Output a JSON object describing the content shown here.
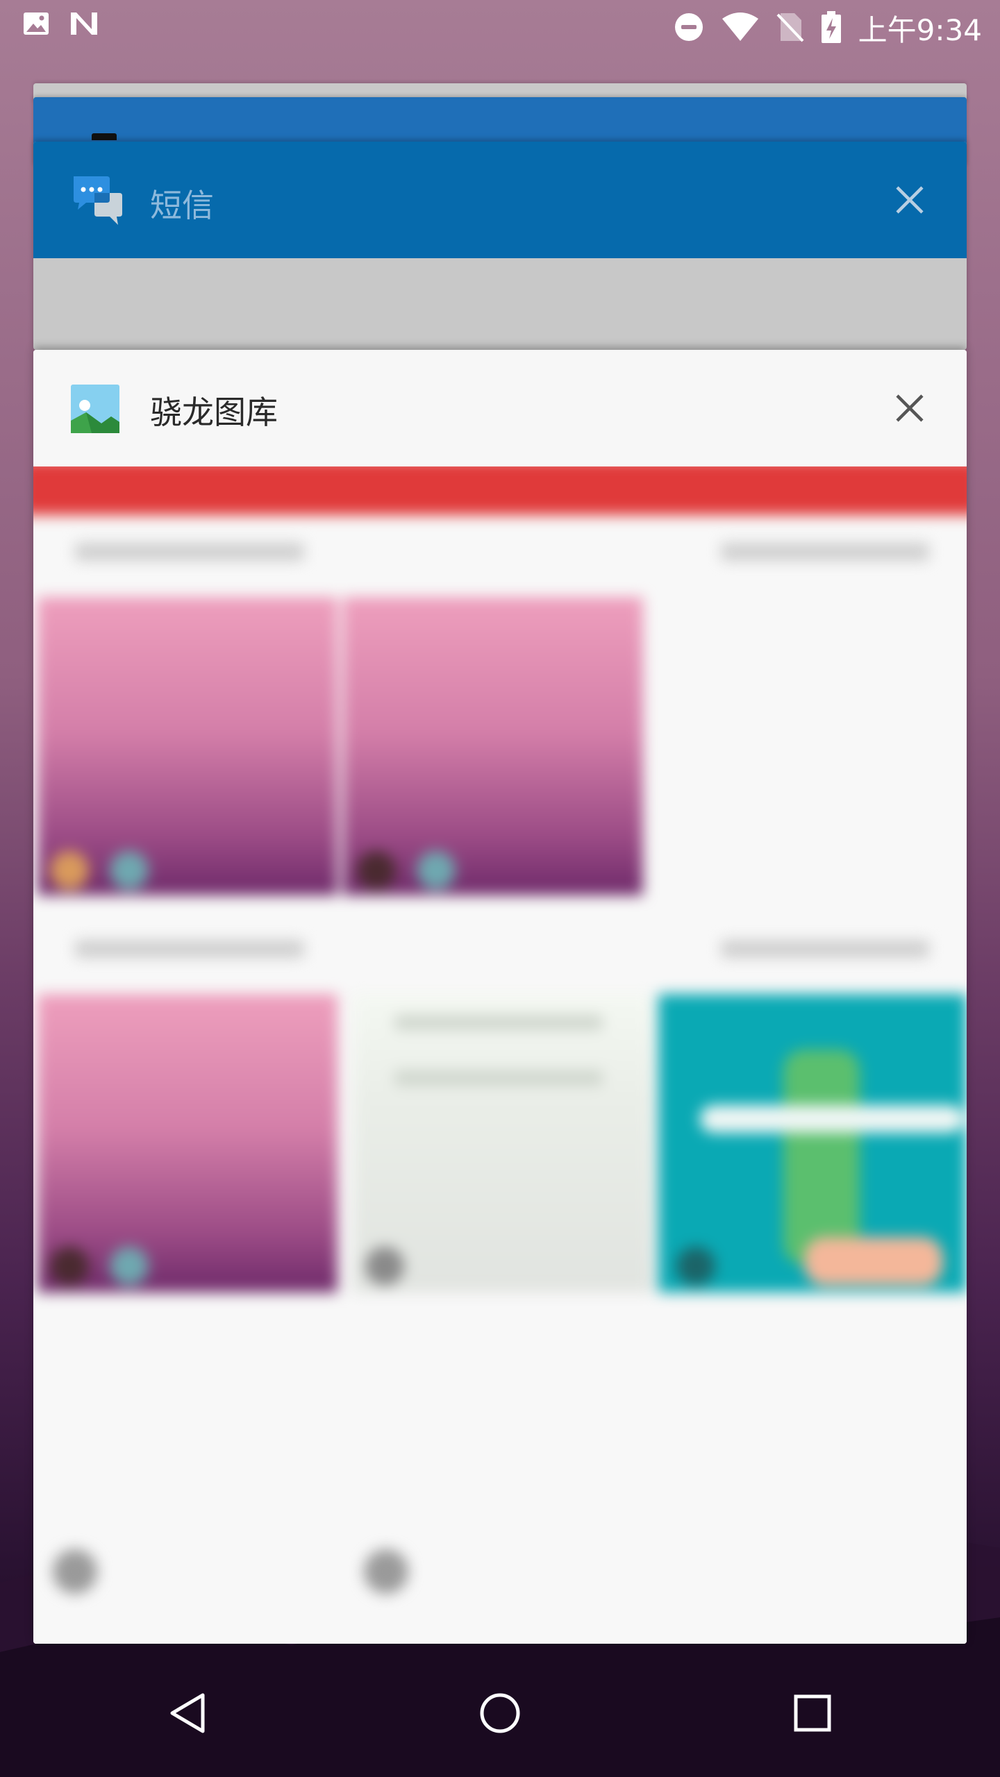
{
  "status_bar": {
    "time": "上午9:34",
    "left_icons": [
      "image-notification-icon",
      "n-notification-icon"
    ],
    "right_icons": [
      "do-not-disturb-icon",
      "wifi-icon",
      "no-sim-icon",
      "battery-charging-icon"
    ]
  },
  "recents": {
    "cards": [
      {
        "title": "短信",
        "icon": "sms-app-icon",
        "close_icon": "close-icon",
        "header_color": "#066aac"
      },
      {
        "title": "骁龙图库",
        "icon": "gallery-app-icon",
        "close_icon": "close-icon",
        "header_color": "#f7f7f7"
      }
    ]
  },
  "nav_bar": {
    "buttons": [
      "back-icon",
      "home-icon",
      "recents-icon"
    ]
  },
  "colors": {
    "sms_header": "#066aac",
    "gallery_accent": "#e03a3a",
    "teal_thumb": "#0aa9b4"
  }
}
